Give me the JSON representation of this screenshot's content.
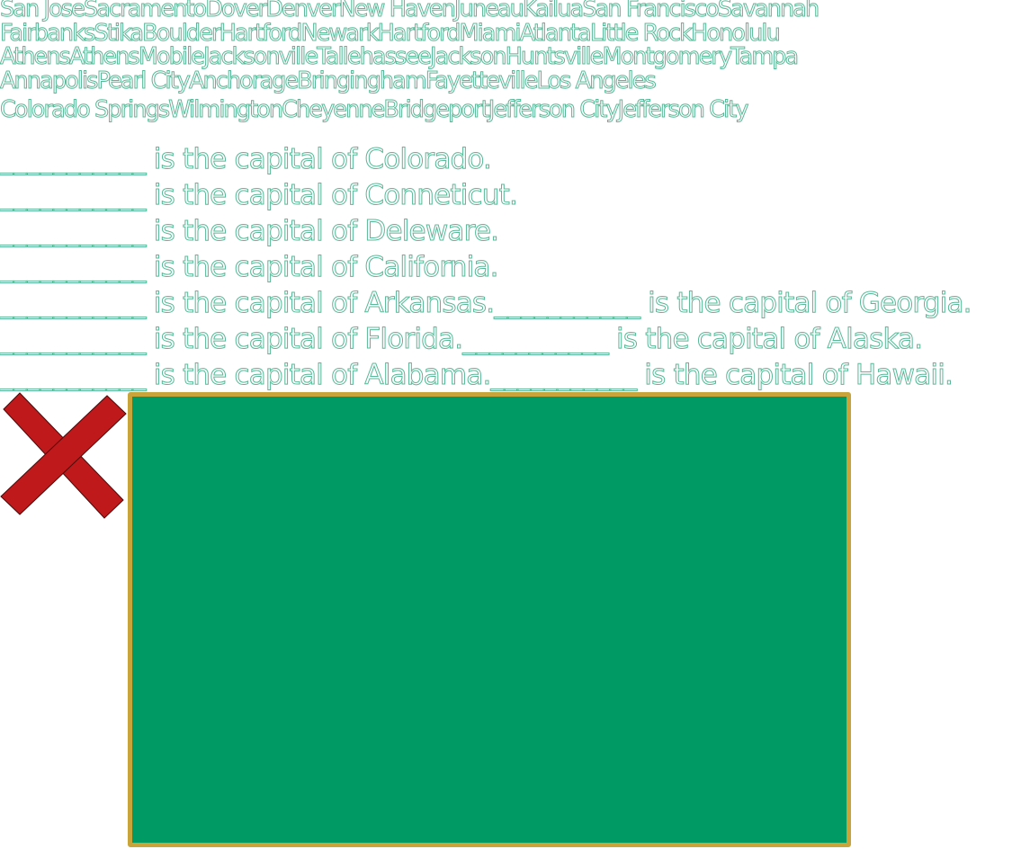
{
  "word_bank": {
    "lines": [
      [
        "San Jose",
        "Sacramento",
        "Dover",
        "Denver",
        "New Haven",
        "Juneau",
        "Kailua",
        "San Francisco",
        "Savannah"
      ],
      [
        "Fairbanks",
        "Stika",
        "Boulder",
        "Hartford",
        "Newark",
        "Hartford",
        "Miami",
        "Atlanta",
        "Little Rock",
        "Honolulu"
      ],
      [
        "Athens",
        "Athens",
        "Mobile",
        "Jacksonville",
        "Tallehassee",
        "Jackson",
        "Huntsville",
        "Montgomery",
        "Tampa"
      ],
      [
        "Annapolis",
        "Pearl City",
        "Anchorage",
        "Bringingham",
        "Fayetteville",
        "Los Angeles"
      ],
      [
        "Colorado Springs",
        "Wilmington",
        "Cheyenne",
        "Bridgeport",
        "Jefferson City",
        "Jefferson City"
      ]
    ]
  },
  "sentences": [
    [
      {
        "blank": "___________",
        "text": " is the capital of Colorado."
      }
    ],
    [
      {
        "blank": "___________",
        "text": " is the capital of Conneticut."
      }
    ],
    [
      {
        "blank": "___________",
        "text": " is the capital of Deleware."
      }
    ],
    [
      {
        "blank": "___________",
        "text": " is the capital of California."
      }
    ],
    [
      {
        "blank": "___________",
        "text": " is the capital of Arkansas."
      },
      {
        "blank": "___________",
        "text": " is the capital of Georgia."
      }
    ],
    [
      {
        "blank": "___________",
        "text": " is the capital of Florida."
      },
      {
        "blank": "___________",
        "text": " is the capital of Alaska."
      }
    ],
    [
      {
        "blank": "___________",
        "text": " is the capital of Alabama."
      },
      {
        "blank": "___________",
        "text": " is the capital of Hawaii."
      }
    ]
  ],
  "close_button": {
    "icon": "close-icon",
    "color": "#c0191c",
    "outline": "#4a0a0a"
  },
  "board": {
    "fill": "#009a64",
    "border": "#c9a43a"
  }
}
